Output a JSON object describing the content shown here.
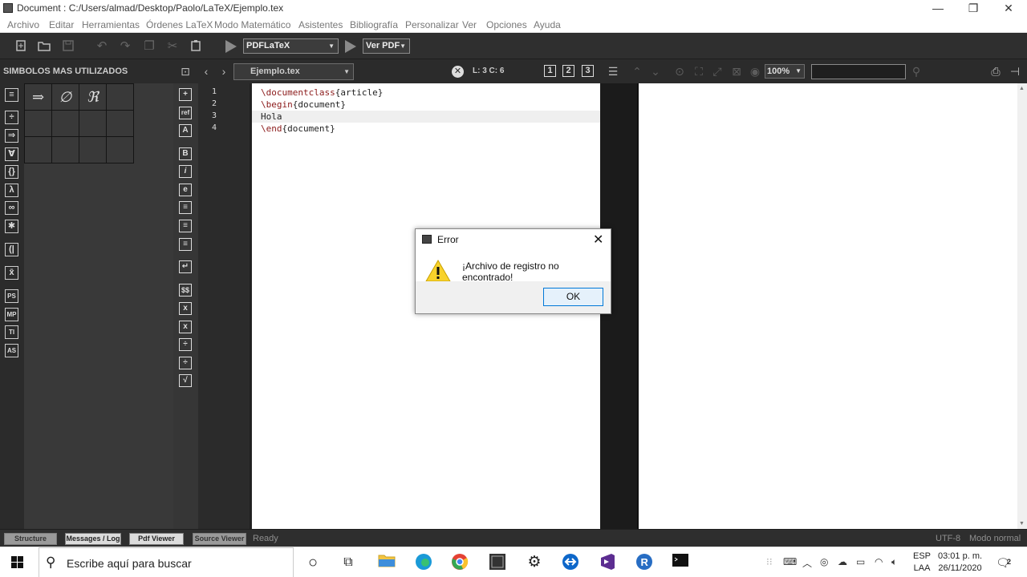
{
  "window": {
    "title": "Document : C:/Users/almad/Desktop/Paolo/LaTeX/Ejemplo.tex",
    "minimize": "—",
    "restore": "❐",
    "close": "✕"
  },
  "menubar": {
    "items": [
      "Archivo",
      "Editar",
      "Herramientas",
      "Órdenes LaTeX",
      "Modo Matemático",
      "Asistentes",
      "Bibliografía",
      "Personalizar",
      "Ver",
      "Opciones",
      "Ayuda"
    ]
  },
  "toolbar": {
    "compiler": "PDFLaTeX",
    "viewer": "Ver PDF",
    "icons": [
      "new-file-icon",
      "open-folder-icon",
      "save-icon",
      "undo-icon",
      "redo-icon",
      "copy-icon",
      "cut-icon",
      "paste-icon",
      "run-icon",
      "view-run-icon"
    ]
  },
  "structure_panel": {
    "title": "SIMBOLOS MAS UTILIZADOS",
    "side_icons": [
      "≡",
      "÷",
      "⇒",
      "∀",
      "{}",
      "λ",
      "∞",
      "✱",
      "(|",
      "x̄",
      "PS",
      "MP",
      "TI",
      "AS"
    ],
    "symbols": [
      "⇒",
      "∅",
      "ℜ"
    ]
  },
  "latex_bar": {
    "icons": [
      "+",
      "ref",
      "A",
      "B",
      "i",
      "e",
      "≡",
      "≡",
      "≡",
      "↵",
      "$$",
      "x",
      "x",
      "÷",
      "÷",
      "√"
    ]
  },
  "editor": {
    "tab": "Ejemplo.tex",
    "cursor": "L: 3 C: 6",
    "view_buttons": [
      "1",
      "2",
      "3"
    ],
    "lines": [
      {
        "num": "1",
        "cmd": "\\documentclass",
        "arg": "{article}"
      },
      {
        "num": "2",
        "cmd": "\\begin",
        "arg": "{document}"
      },
      {
        "num": "3",
        "cmd": "",
        "arg": "Hola"
      },
      {
        "num": "4",
        "cmd": "\\end",
        "arg": "{document}"
      }
    ]
  },
  "pdf_viewer": {
    "zoom": "100%",
    "search_value": ""
  },
  "statusbar": {
    "buttons": [
      "Structure",
      "Messages / Log",
      "Pdf Viewer",
      "Source Viewer"
    ],
    "status": "Ready",
    "encoding": "UTF-8",
    "mode": "Modo normal"
  },
  "dialog": {
    "title": "Error",
    "message": "¡Archivo de registro no encontrado!",
    "ok": "OK"
  },
  "taskbar": {
    "search_placeholder": "Escribe aquí para buscar",
    "lang_top": "ESP",
    "lang_bottom": "LAA",
    "time": "03:01 p. m.",
    "date": "26/11/2020",
    "notification_count": "2"
  },
  "colors": {
    "accent": "#0078d7",
    "background": "#2b2b2b",
    "keyword": "#8b1a1a"
  }
}
